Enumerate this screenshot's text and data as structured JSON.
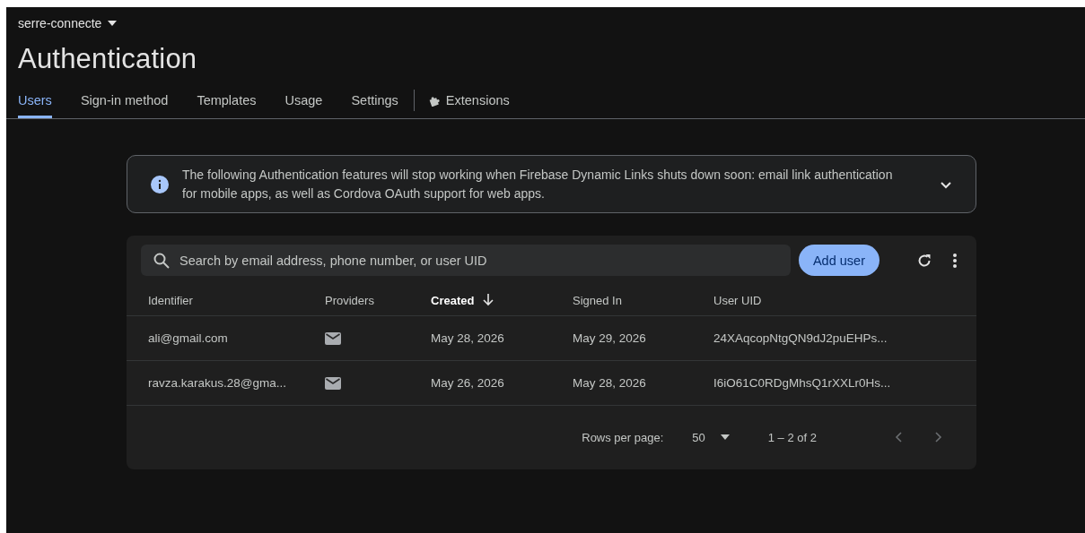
{
  "project": {
    "name": "serre-connecte"
  },
  "page_title": "Authentication",
  "tabs": [
    {
      "label": "Users",
      "selected": true
    },
    {
      "label": "Sign-in method",
      "selected": false
    },
    {
      "label": "Templates",
      "selected": false
    },
    {
      "label": "Usage",
      "selected": false
    },
    {
      "label": "Settings",
      "selected": false
    },
    {
      "label": "Extensions",
      "selected": false,
      "kind": "extension"
    }
  ],
  "notice": {
    "text": "The following Authentication features will stop working when Firebase Dynamic Links shuts down soon: email link authentication for mobile apps, as well as Cordova OAuth support for web apps.",
    "expanded": false
  },
  "search": {
    "placeholder": "Search by email address, phone number, or user UID"
  },
  "add_button": "Add user",
  "table": {
    "columns": [
      {
        "label": "Identifier",
        "sorted": false
      },
      {
        "label": "Providers",
        "sorted": false
      },
      {
        "label": "Created",
        "sorted": true
      },
      {
        "label": "Signed In",
        "sorted": false
      },
      {
        "label": "User UID",
        "sorted": false
      }
    ],
    "rows": [
      {
        "identifier": "ali@gmail.com",
        "providers": [
          {
            "kind": "email"
          }
        ],
        "created": "May 28, 2026",
        "signed_in": "May 29, 2026",
        "uid": "24XAqcopNtgQN9dJ2puEHPs..."
      },
      {
        "identifier": "ravza.karakus.28@gma...",
        "providers": [
          {
            "kind": "email"
          }
        ],
        "created": "May 26, 2026",
        "signed_in": "May 28, 2026",
        "uid": "I6iO61C0RDgMhsQ1rXXLr0Hs..."
      }
    ]
  },
  "pagination": {
    "rows_label": "Rows per page:",
    "rows_value": "50",
    "range": "1 – 2 of 2"
  }
}
